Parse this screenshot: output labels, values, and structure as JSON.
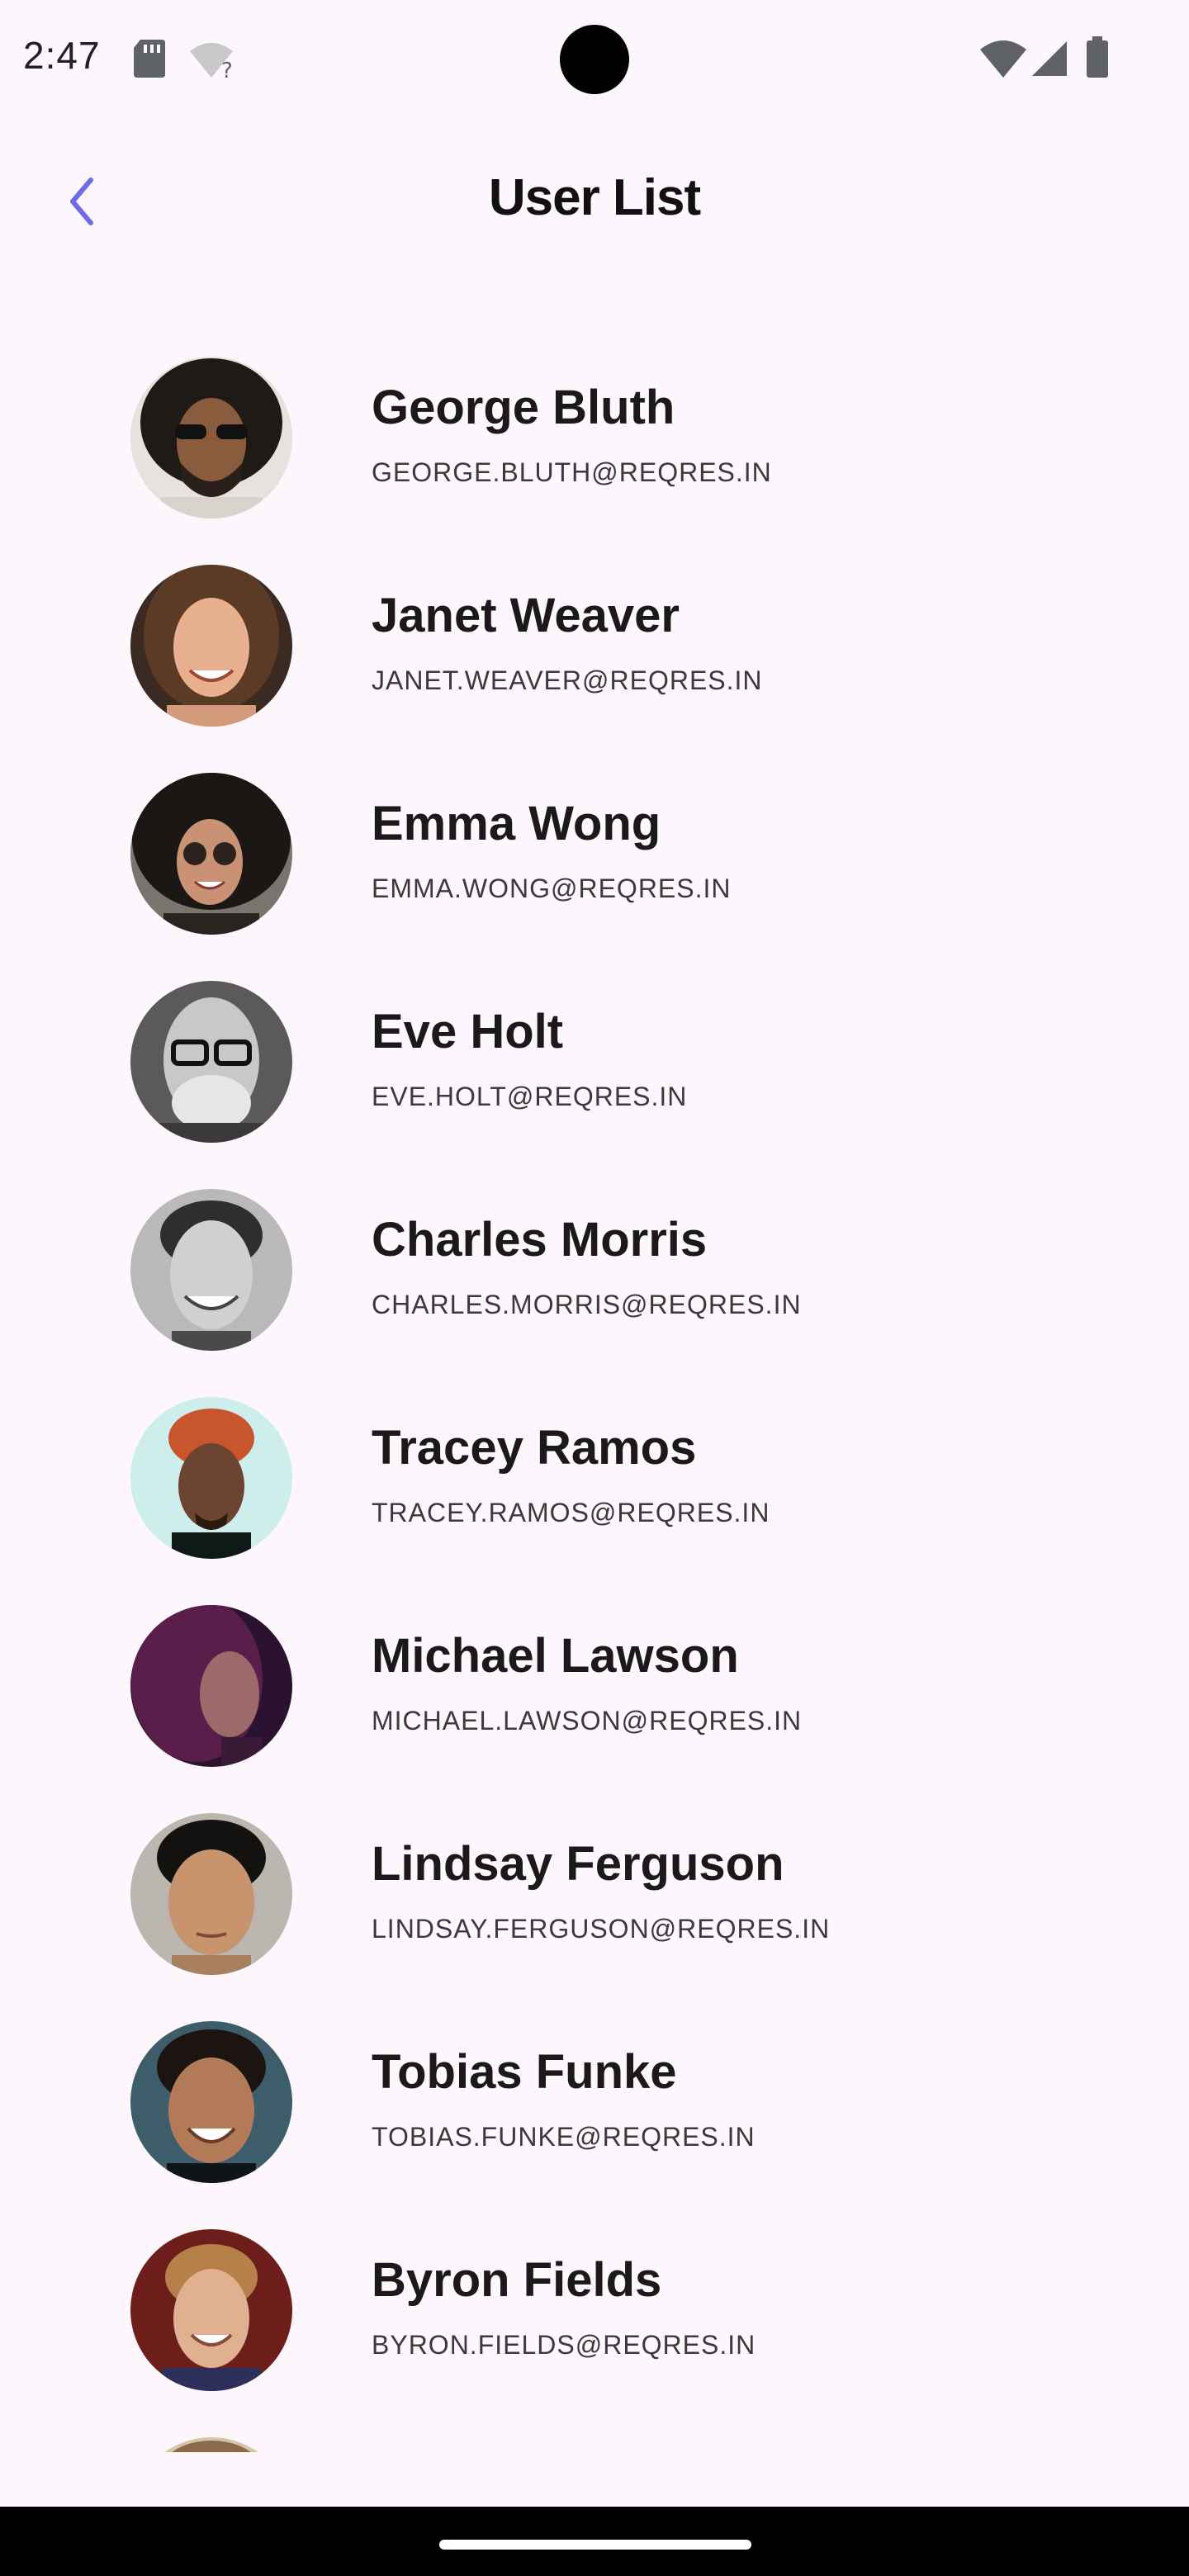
{
  "status_bar": {
    "time": "2:47",
    "icons": [
      "sd-card-icon",
      "wifi-question-icon",
      "wifi-icon",
      "cell-signal-icon",
      "battery-icon"
    ]
  },
  "app_bar": {
    "title": "User List",
    "back_icon": "chevron-left-icon",
    "accent_color": "#6f6ae8"
  },
  "users": [
    {
      "name": "George Bluth",
      "email": "GEORGE.BLUTH@REQRES.IN"
    },
    {
      "name": "Janet Weaver",
      "email": "JANET.WEAVER@REQRES.IN"
    },
    {
      "name": "Emma Wong",
      "email": "EMMA.WONG@REQRES.IN"
    },
    {
      "name": "Eve Holt",
      "email": "EVE.HOLT@REQRES.IN"
    },
    {
      "name": "Charles Morris",
      "email": "CHARLES.MORRIS@REQRES.IN"
    },
    {
      "name": "Tracey Ramos",
      "email": "TRACEY.RAMOS@REQRES.IN"
    },
    {
      "name": "Michael Lawson",
      "email": "MICHAEL.LAWSON@REQRES.IN"
    },
    {
      "name": "Lindsay Ferguson",
      "email": "LINDSAY.FERGUSON@REQRES.IN"
    },
    {
      "name": "Tobias Funke",
      "email": "TOBIAS.FUNKE@REQRES.IN"
    },
    {
      "name": "Byron Fields",
      "email": "BYRON.FIELDS@REQRES.IN"
    }
  ],
  "colors": {
    "background": "#fdf7fd",
    "accent": "#6f6ae8"
  }
}
